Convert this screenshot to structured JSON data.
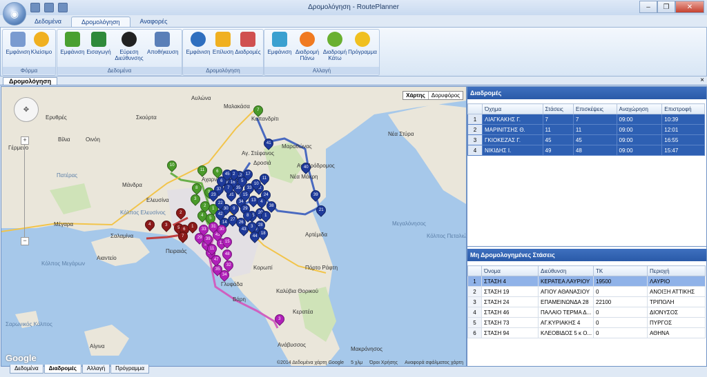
{
  "window": {
    "title": "Δρομολόγηση - RoutePlanner",
    "min": "‒",
    "max": "❐",
    "close": "✕"
  },
  "ribbon_tabs": [
    "Δεδομένα",
    "Δρομολόγηση",
    "Αναφορές"
  ],
  "groups": [
    {
      "label": "Φόρμα",
      "buttons": [
        "Εμφάνιση",
        "Κλείσιμο"
      ]
    },
    {
      "label": "Δεδομένα",
      "buttons": [
        "Εμφάνιση",
        "Εισαγωγή",
        "Εύρεση Διεύθυνσης",
        "Αποθήκευση"
      ]
    },
    {
      "label": "Δρομολόγηση",
      "buttons": [
        "Εμφάνιση",
        "Επίλυση",
        "Διαδρομές"
      ]
    },
    {
      "label": "Αλλαγή",
      "buttons": [
        "Εμφάνιση",
        "Διαδρομή Πάνω",
        "Διαδρομή Κάτω",
        "Πρόγραμμα"
      ]
    }
  ],
  "doc_tab": "Δρομολόγηση",
  "doc_close": "×",
  "map": {
    "type_map": "Χάρτης",
    "type_sat": "Δορυφόρος",
    "logo": "Google",
    "copyright": "©2014 Δεδομένα χάρτη Google",
    "scale": "5 χλμ",
    "terms": "Όροι Χρήσης",
    "report": "Αναφορά σφάλματος χάρτη",
    "zoom_in": "+",
    "zoom_out": "−",
    "places": [
      "Αυλώνα",
      "Μαλακάσα",
      "Καπανδρίτι",
      "Ερυθρές",
      "Σκούρτα",
      "Βίλια",
      "Οινόη",
      "Γέρμενο",
      "Πατέρας",
      "Μάνδρα",
      "Ελευσίνα",
      "Μέγαρα",
      "Κόλπος Ελευσίνος",
      "Σαλαμίνα",
      "Αιαντείο",
      "Κόλπος Μεγάρων",
      "Πειραιάς",
      "Γλυφάδα",
      "Βάρη",
      "Κορωπί",
      "Πόρτο Ράφτη",
      "Καλύβια Θορικού",
      "Κερατέα",
      "Ανάβυσσος",
      "Μαραθώνας",
      "Δροσιά",
      "Νέα Μάκρη",
      "Νέα Στύρα",
      "Αρτέμιδα",
      "Μεγαλόνησος",
      "Κόλπος Πεταλιών",
      "Σαρωνικός Κόλπος",
      "Αίγινα",
      "Μακρόνησος",
      "Αχαρνές",
      "Αγ. Στέφανος",
      "Αγ. Πρόδρομος"
    ]
  },
  "routes_panel": {
    "title": "Διαδρομές",
    "columns": [
      "Όχημα",
      "Στάσεις",
      "Επισκέψεις",
      "Αναχώρηση",
      "Επιστροφή"
    ],
    "rows": [
      [
        "1",
        "ΛΙΑΓΚΑΚΗΣ Γ.",
        "7",
        "7",
        "09:00",
        "10:39"
      ],
      [
        "2",
        "ΜΑΡΙΝΙΤΣΗΣ Θ.",
        "11",
        "11",
        "09:00",
        "12:01"
      ],
      [
        "3",
        "ΓΚΙΟΚΕΖΑΣ Γ.",
        "45",
        "45",
        "09:00",
        "16:55"
      ],
      [
        "4",
        "ΝΙΚΙΔΗΣ Ι.",
        "49",
        "48",
        "09:00",
        "15:47"
      ]
    ]
  },
  "unrouted_panel": {
    "title": "Μη Δρομολογημένες Στάσεις",
    "columns": [
      "Όνομα",
      "Διεύθυνση",
      "ΤΚ",
      "Περιοχή"
    ],
    "rows": [
      [
        "1",
        "ΣΤΑΣΗ 4",
        "ΚΕΡΑΤΕΑ ΛΑΥΡΙΟΥ",
        "19500",
        "ΛΑΥΡΙΟ"
      ],
      [
        "2",
        "ΣΤΑΣΗ 19",
        "ΑΓΙΟΥ ΑΘΑΝΑΣΙΟΥ",
        "0",
        "ΑΝΟΙΞΗ ΑΤΤΙΚΗΣ"
      ],
      [
        "3",
        "ΣΤΑΣΗ 24",
        "ΕΠΑΜΕΙΝΩΝΔΑ 28",
        "22100",
        "ΤΡΙΠΟΛΗ"
      ],
      [
        "4",
        "ΣΤΑΣΗ 46",
        "ΠΑΛΑΙΟ ΤΕΡΜΑ Δ...",
        "0",
        "ΔΙΟΝΥΣΟΣ"
      ],
      [
        "5",
        "ΣΤΑΣΗ 73",
        "ΑΓ.ΚΥΡΙΑΚΗΣ 4",
        "0",
        "ΠΥΡΓΟΣ"
      ],
      [
        "6",
        "ΣΤΑΣΗ 94",
        "ΚΛΕΟΒΙΔΟΣ 5 κ Ο...",
        "0",
        "ΑΘΗΝΑ"
      ]
    ]
  },
  "bottom_tabs": [
    "Δεδομένα",
    "Διαδρομές",
    "Αλλαγή",
    "Πρόγραμμα"
  ],
  "pin_colors": {
    "route1": "#8b1a1a",
    "route2": "#4a9a2a",
    "route3": "#1e3a9a",
    "route4": "#b020b8"
  },
  "pins": {
    "route1": [
      "4",
      "3",
      "2",
      "5",
      "6",
      "7",
      "1"
    ],
    "route2": [
      "7",
      "10",
      "11",
      "6",
      "8",
      "9",
      "3",
      "2",
      "1",
      "4",
      "5"
    ],
    "route3": [
      "41",
      "40",
      "39",
      "38",
      "37",
      "36",
      "35",
      "34",
      "33",
      "32",
      "31",
      "30",
      "29",
      "28",
      "27",
      "26",
      "25",
      "24",
      "23",
      "22",
      "21",
      "20",
      "19",
      "18",
      "17",
      "16",
      "15",
      "14",
      "13",
      "12",
      "11",
      "10",
      "9",
      "8",
      "7",
      "6",
      "5",
      "4",
      "3",
      "2",
      "1",
      "42",
      "43",
      "44",
      "45"
    ],
    "route4": [
      "3",
      "32",
      "34",
      "35",
      "36",
      "38",
      "43",
      "13",
      "11",
      "15",
      "30",
      "31",
      "33",
      "29",
      "39",
      "47",
      "48"
    ]
  }
}
